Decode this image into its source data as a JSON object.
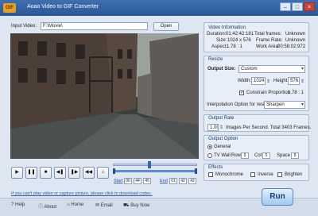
{
  "window": {
    "title": "Aoao Video to GIF Converter",
    "app_icon": "GIF"
  },
  "input": {
    "label": "Input Video:",
    "value": "F:\\Movie\\",
    "open_label": "Open"
  },
  "video_info": {
    "title": "Video Information",
    "duration_label": "Duration:",
    "duration": "01:42:42:181",
    "total_frames_label": "Total frames:",
    "total_frames": "Unknown",
    "size_label": "Size:",
    "size": "1024 x 576",
    "frame_rate_label": "Frame Rate:",
    "frame_rate": "Unknown",
    "aspect_label": "Aspect:",
    "aspect": "1.78 : 1",
    "work_area_label": "Work Area:",
    "work_area": "00:58:02:972"
  },
  "resize": {
    "title": "Resize",
    "output_size_label": "Output Size:",
    "output_size_value": "Custom",
    "width_label": "Width:",
    "width": "1024",
    "height_label": "Height:",
    "height": "576",
    "constrain_label": "Constrain Proportion",
    "constrain_ratio": "1.78 : 1",
    "interp_label": "Interpolation Option for resize:",
    "interp_value": "Sharpen"
  },
  "output_rate": {
    "title": "Output Rate",
    "value": "1.00",
    "text": "Images Per Second. Total 3403 Frames."
  },
  "output_option": {
    "title": "Output Option",
    "general_label": "General",
    "tv_wall_label": "TV Wall",
    "row_label": "Row",
    "row": "5",
    "col_label": "Col",
    "col": "5",
    "space_label": "Space",
    "space": "8"
  },
  "effects": {
    "title": "Effects",
    "monochrome": "Monochrome",
    "inverse": "Inverse",
    "brighten": "Brighten"
  },
  "controls": {
    "play": "▶",
    "pause": "❚❚",
    "stop": "■",
    "prev": "◀❚",
    "next": "❚▶",
    "rewind": "◀◀",
    "snapshot": "⌂"
  },
  "timeline": {
    "start_label": "Start",
    "start_values": [
      "00",
      "44",
      "45"
    ],
    "end_label": "End",
    "end_values": [
      "01",
      "42",
      "42"
    ]
  },
  "footer": {
    "link": "If you can't play video or capture picture, please click to download codec.",
    "help": "Help",
    "about": "About",
    "home": "Home",
    "email": "Email",
    "buy_now": "Buy Now",
    "run": "Run"
  }
}
